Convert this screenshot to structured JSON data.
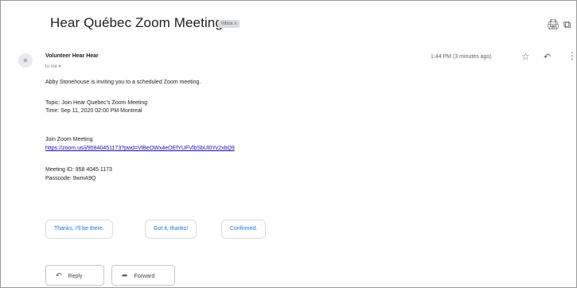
{
  "email": {
    "subject": "Hear Québec Zoom Meeting",
    "label": "Inbox x",
    "sender": "Volunteer Hear Hear",
    "to": "to me ▾",
    "time": "1:44 PM (3 minutes ago)",
    "body": {
      "intro": "Abby Stonehouse is inviting you to a scheduled Zoom meeting.",
      "topic": "Topic: Join Hear Quebec's Zoom Meeting",
      "time": "Time: Sep 11, 2020 02:00 PM Montreal",
      "join_heading": "Join Zoom Meeting",
      "join_link": "https://zoom.us/j/95840451173?pwd=VlBeOWx4eOEfYUFVlbSbUl0Yv2xbQ9",
      "meeting_id": "Meeting ID: 958 4045 1173",
      "passcode": "Passcode: 9wmA9Q"
    }
  },
  "smart_replies": [
    "Thanks, I'll be there.",
    "Got it, thanks!",
    "Confirmed."
  ],
  "actions": {
    "reply": "Reply",
    "forward": "Forward"
  },
  "icons": {
    "print": "print-icon",
    "new_window": "open-in-new-window-icon",
    "star": "star-icon",
    "reply": "reply-icon",
    "more": "more-vertical-icon",
    "avatar": "person-icon"
  }
}
